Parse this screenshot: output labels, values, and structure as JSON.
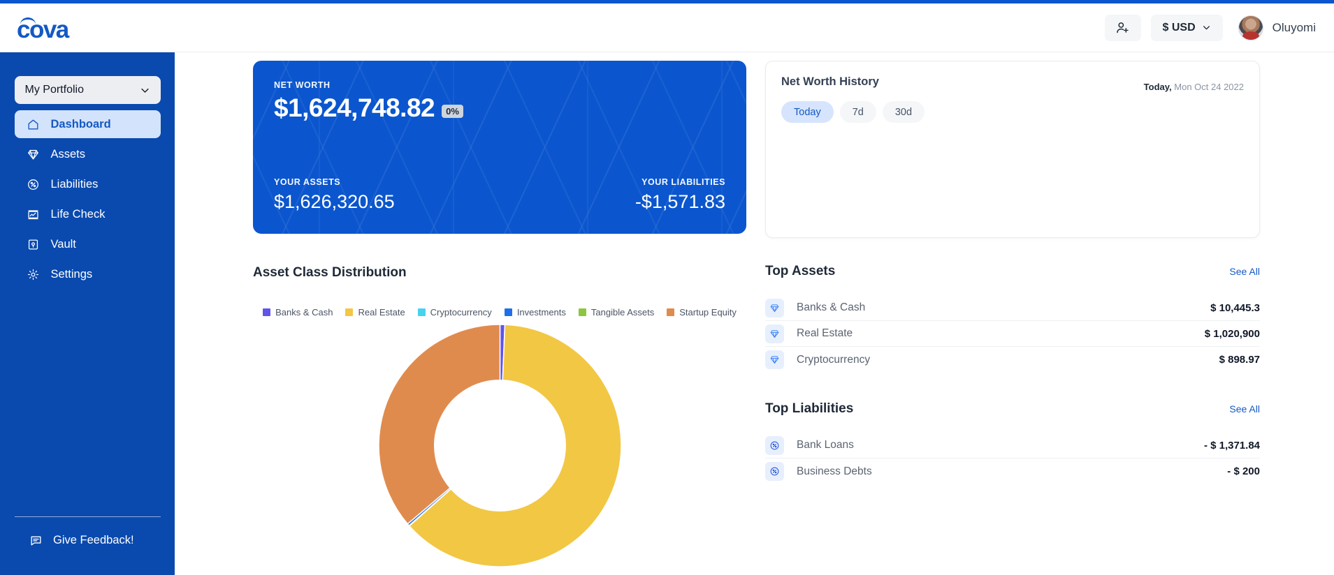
{
  "brand": {
    "logo_text": "cova",
    "primary": "#0B56CE",
    "sidebar_bg": "#0A4AAF",
    "accent_link": "#1459C4"
  },
  "header": {
    "add_user_icon": "add-user-icon",
    "currency": {
      "label": "$ USD",
      "chevron_icon": "chevron-down-icon"
    },
    "user": {
      "name": "Oluyomi",
      "avatar_icon": "avatar"
    }
  },
  "sidebar": {
    "portfolio": {
      "label": "My Portfolio",
      "chevron_icon": "chevron-down-icon"
    },
    "items": [
      {
        "label": "Dashboard",
        "icon": "home-icon",
        "active": true
      },
      {
        "label": "Assets",
        "icon": "diamond-icon",
        "active": false
      },
      {
        "label": "Liabilities",
        "icon": "percent-circle-icon",
        "active": false
      },
      {
        "label": "Life Check",
        "icon": "chart-box-icon",
        "active": false
      },
      {
        "label": "Vault",
        "icon": "safe-icon",
        "active": false
      },
      {
        "label": "Settings",
        "icon": "gear-icon",
        "active": false
      }
    ],
    "feedback": {
      "label": "Give Feedback!",
      "icon": "message-icon"
    }
  },
  "net_worth_card": {
    "caption": "NET WORTH",
    "value": "$1,624,748.82",
    "change_badge": "0%",
    "assets_caption": "YOUR ASSETS",
    "assets_value": "$1,626,320.65",
    "liabilities_caption": "YOUR LIABILITIES",
    "liabilities_value": "-$1,571.83"
  },
  "net_worth_history": {
    "title": "Net Worth History",
    "date_prefix": "Today,",
    "date": "Mon Oct 24 2022",
    "pills": [
      {
        "label": "Today",
        "active": true
      },
      {
        "label": "7d",
        "active": false
      },
      {
        "label": "30d",
        "active": false
      }
    ]
  },
  "asset_class_distribution": {
    "title": "Asset Class Distribution"
  },
  "chart_data": {
    "type": "pie",
    "title": "Asset Class Distribution",
    "donut": true,
    "inner_radius_ratio": 0.54,
    "legend_position": "top-center",
    "grid": false,
    "start_angle_deg": -90,
    "categories": [
      "Banks & Cash",
      "Real Estate",
      "Cryptocurrency",
      "Investments",
      "Tangible Assets",
      "Startup Equity"
    ],
    "colors": [
      "#6254E8",
      "#F2C744",
      "#45D3F0",
      "#1F6FEB",
      "#8CC63F",
      "#E08B4E"
    ],
    "values": [
      10445.3,
      1020900,
      898.97,
      1200,
      0,
      594000
    ],
    "percents": [
      0.64,
      62.8,
      0.06,
      0.3,
      0,
      36.2
    ],
    "unit": "USD"
  },
  "top_assets": {
    "title": "Top Assets",
    "see_all": "See All",
    "rows": [
      {
        "label": "Banks & Cash",
        "value": "$ 10,445.3",
        "icon": "diamond-icon"
      },
      {
        "label": "Real Estate",
        "value": "$ 1,020,900",
        "icon": "diamond-icon"
      },
      {
        "label": "Cryptocurrency",
        "value": "$ 898.97",
        "icon": "diamond-icon"
      }
    ]
  },
  "top_liabilities": {
    "title": "Top Liabilities",
    "see_all": "See All",
    "rows": [
      {
        "label": "Bank Loans",
        "value": "- $ 1,371.84",
        "icon": "percent-circle-icon"
      },
      {
        "label": "Business Debts",
        "value": "- $ 200",
        "icon": "percent-circle-icon"
      }
    ]
  }
}
